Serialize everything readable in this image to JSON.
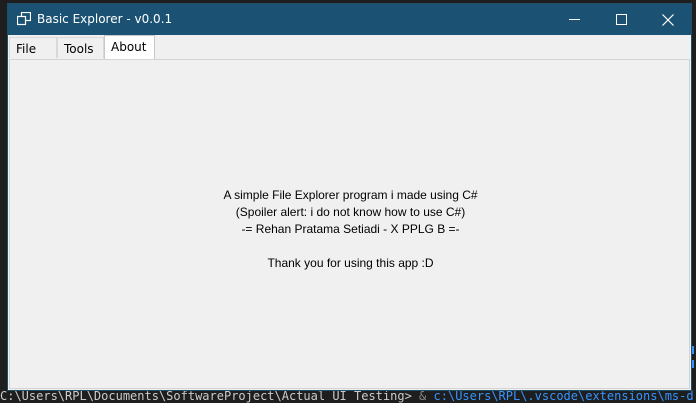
{
  "window": {
    "title": "Basic Explorer - v0.0.1",
    "titlebar_color": "#1b5273"
  },
  "tabs": [
    {
      "label": "File",
      "selected": false
    },
    {
      "label": "Tools",
      "selected": false
    },
    {
      "label": "About",
      "selected": true
    }
  ],
  "about": {
    "line1": "A simple File Explorer program i made using C#",
    "line2": "(Spoiler alert: i do not know how to use C#)",
    "line3": "-= Rehan Pratama Setiadi - X PPLG B =-",
    "line4": "Thank you for using this app :D"
  },
  "terminal": {
    "path1": "C:\\Users\\RPL\\Documents\\SoftwareProject\\Actual UI Testing>",
    "separator": "&",
    "path2": "c:\\Users\\RPL\\.vscode\\extensions\\ms-d"
  }
}
